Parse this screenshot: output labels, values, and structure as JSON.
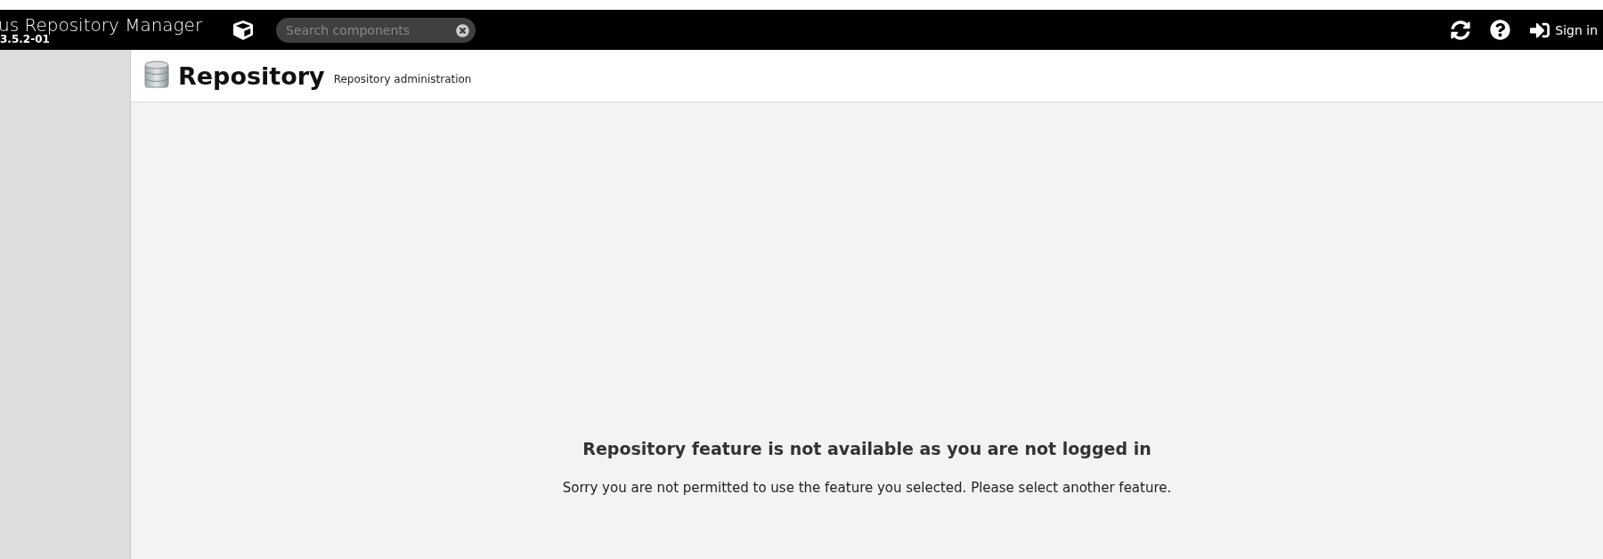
{
  "header": {
    "product_name": "us Repository Manager",
    "version": "3.5.2-01",
    "search": {
      "placeholder": "Search components"
    },
    "sign_in": "Sign in"
  },
  "page": {
    "title": "Repository",
    "subtitle": "Repository administration"
  },
  "message": {
    "heading": "Repository feature is not available as you are not logged in",
    "body": "Sorry you are not permitted to use the feature you selected. Please select another feature."
  }
}
